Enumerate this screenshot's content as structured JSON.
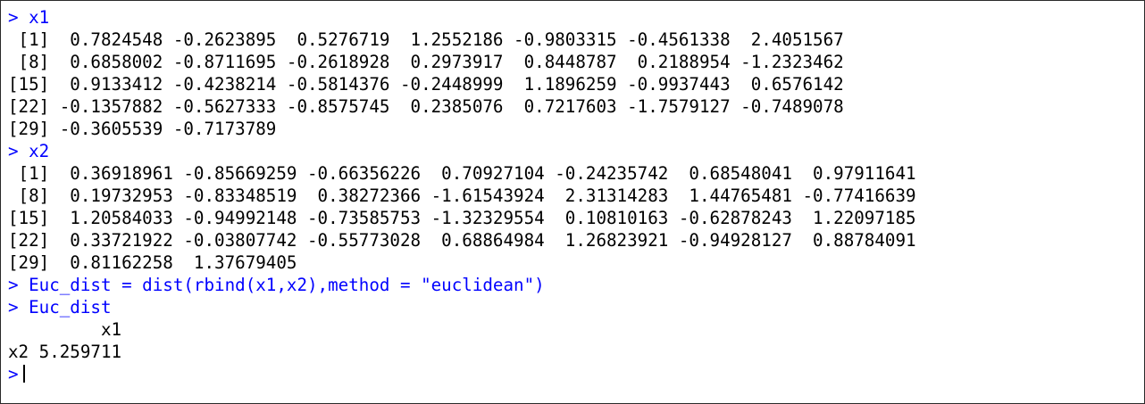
{
  "console": {
    "prompt": ">",
    "lines": [
      {
        "kind": "cmd",
        "text": "> x1"
      },
      {
        "kind": "out",
        "text": " [1]  0.7824548 -0.2623895  0.5276719  1.2552186 -0.9803315 -0.4561338  2.4051567"
      },
      {
        "kind": "out",
        "text": " [8]  0.6858002 -0.8711695 -0.2618928  0.2973917  0.8448787  0.2188954 -1.2323462"
      },
      {
        "kind": "out",
        "text": "[15]  0.9133412 -0.4238214 -0.5814376 -0.2448999  1.1896259 -0.9937443  0.6576142"
      },
      {
        "kind": "out",
        "text": "[22] -0.1357882 -0.5627333 -0.8575745  0.2385076  0.7217603 -1.7579127 -0.7489078"
      },
      {
        "kind": "out",
        "text": "[29] -0.3605539 -0.7173789"
      },
      {
        "kind": "cmd",
        "text": "> x2"
      },
      {
        "kind": "out",
        "text": " [1]  0.36918961 -0.85669259 -0.66356226  0.70927104 -0.24235742  0.68548041  0.97911641"
      },
      {
        "kind": "out",
        "text": " [8]  0.19732953 -0.83348519  0.38272366 -1.61543924  2.31314283  1.44765481 -0.77416639"
      },
      {
        "kind": "out",
        "text": "[15]  1.20584033 -0.94992148 -0.73585753 -1.32329554  0.10810163 -0.62878243  1.22097185"
      },
      {
        "kind": "out",
        "text": "[22]  0.33721922 -0.03807742 -0.55773028  0.68864984  1.26823921 -0.94928127  0.88784091"
      },
      {
        "kind": "out",
        "text": "[29]  0.81162258  1.37679405"
      },
      {
        "kind": "cmd",
        "text": "> Euc_dist = dist(rbind(x1,x2),method = \"euclidean\")"
      },
      {
        "kind": "cmd",
        "text": "> Euc_dist"
      },
      {
        "kind": "out",
        "text": "         x1"
      },
      {
        "kind": "out",
        "text": "x2 5.259711"
      }
    ]
  },
  "colors": {
    "command": "#0000ff",
    "output": "#000000",
    "background": "#ffffff"
  }
}
